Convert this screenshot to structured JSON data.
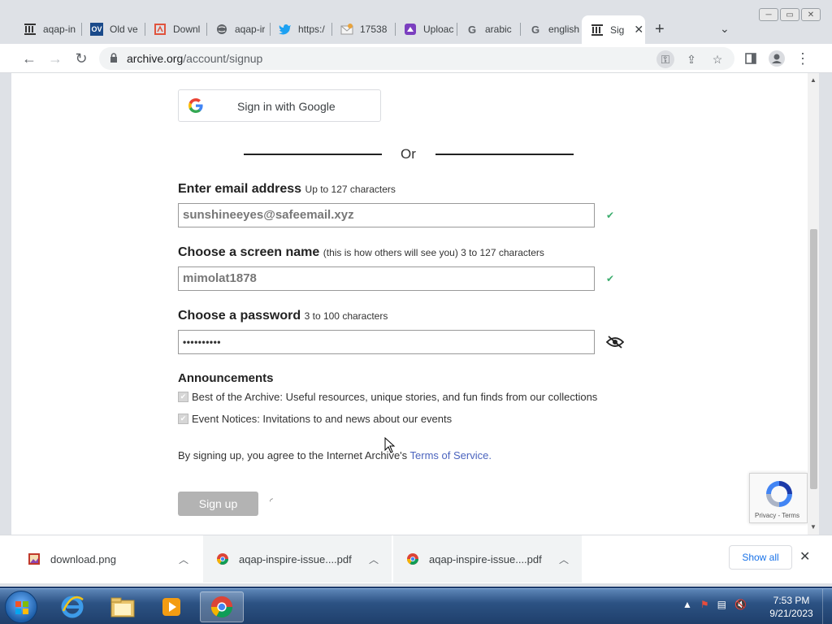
{
  "browser": {
    "tabs": [
      {
        "title": "aqap-in",
        "icon": "archive-icon"
      },
      {
        "title": "Old ve",
        "icon": "ov-icon"
      },
      {
        "title": "Downl",
        "icon": "pdf-icon"
      },
      {
        "title": "aqap-ir",
        "icon": "globe-icon"
      },
      {
        "title": "https:/",
        "icon": "twitter-icon"
      },
      {
        "title": "17538",
        "icon": "mail-icon"
      },
      {
        "title": "Uploac",
        "icon": "upload-icon"
      },
      {
        "title": "arabic",
        "icon": "google-icon"
      },
      {
        "title": "english",
        "icon": "google-icon"
      },
      {
        "title": "Sig",
        "icon": "archive-icon",
        "active": true
      }
    ],
    "url_host": "archive.org",
    "url_path": "/account/signup"
  },
  "page": {
    "google_button": "Sign in with Google",
    "or_text": "Or",
    "email": {
      "label": "Enter email address",
      "hint": "Up to 127 characters",
      "value": "sunshineeyes@safeemail.xyz"
    },
    "screen_name": {
      "label": "Choose a screen name",
      "hint": "(this is how others will see you) 3 to 127 characters",
      "value": "mimolat1878"
    },
    "password": {
      "label": "Choose a password",
      "hint": "3 to 100 characters",
      "value": "••••••••••"
    },
    "announcements": {
      "heading": "Announcements",
      "items": [
        "Best of the Archive: Useful resources, unique stories, and fun finds from our collections",
        "Event Notices: Invitations to and news about our events"
      ]
    },
    "agree_text": "By signing up, you agree to the Internet Archive's",
    "terms_link": "Terms of Service.",
    "signup_button": "Sign up",
    "recaptcha_links": "Privacy - Terms"
  },
  "downloads": {
    "items": [
      {
        "name": "download.png",
        "icon": "image-file-icon"
      },
      {
        "name": "aqap-inspire-issue....pdf",
        "icon": "chrome-icon"
      },
      {
        "name": "aqap-inspire-issue....pdf",
        "icon": "chrome-icon"
      }
    ],
    "show_all": "Show all"
  },
  "taskbar": {
    "time": "7:53 PM",
    "date": "9/21/2023"
  },
  "colors": {
    "link": "#4b64be",
    "check": "#3cad6e",
    "signup_disabled": "#b3b3b3"
  }
}
